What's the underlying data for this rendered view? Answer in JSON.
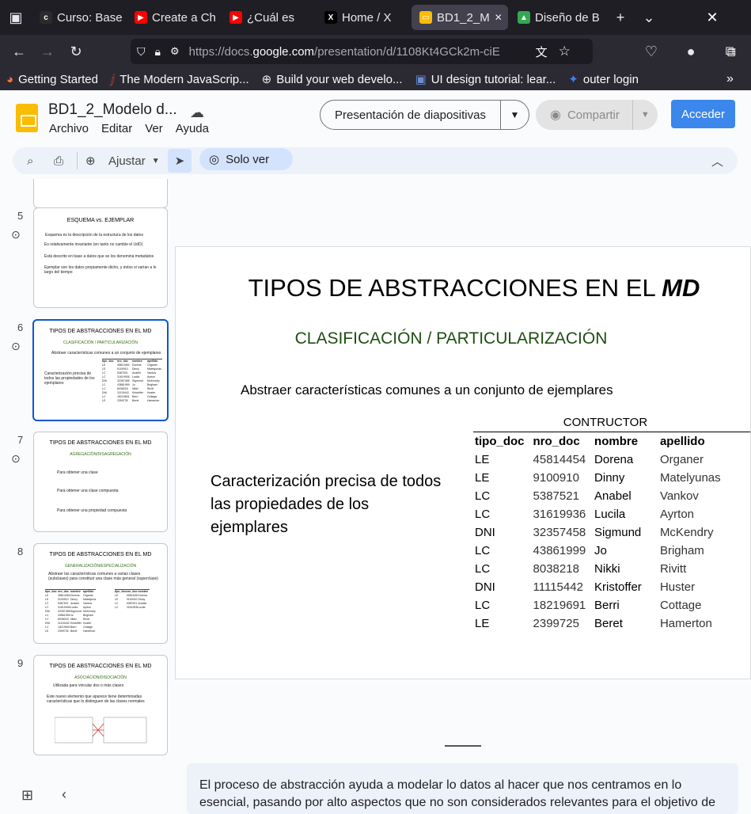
{
  "browser": {
    "tabs": [
      {
        "label": "Curso: Base",
        "icon": "course-icon",
        "color": "#2b2b2b"
      },
      {
        "label": "Create a Ch",
        "icon": "youtube-icon",
        "color": "#ff0000"
      },
      {
        "label": "¿Cuál es",
        "icon": "youtube-icon",
        "color": "#ff0000"
      },
      {
        "label": "Home / X",
        "icon": "x-icon",
        "color": "#000000"
      },
      {
        "label": "BD1_2_M",
        "icon": "slides-icon",
        "color": "#fbbc04"
      },
      {
        "label": "Diseño de B",
        "icon": "drive-icon",
        "color": "#34a853"
      }
    ],
    "url_prefix": "https://docs.",
    "url_domain": "google.com",
    "url_rest": "/presentation/d/1108Kt4GCk2m-ciE",
    "bookmarks": [
      {
        "label": "Getting Started",
        "icon": "firefox-icon"
      },
      {
        "label": "The Modern JavaScrip...",
        "icon": "js-icon"
      },
      {
        "label": "Build your web develo...",
        "icon": "globe-icon"
      },
      {
        "label": "UI design tutorial: lear...",
        "icon": "image-icon"
      },
      {
        "label": "outer login",
        "icon": "outer-icon"
      }
    ]
  },
  "app": {
    "doc_title": "BD1_2_Modelo d...",
    "menu": [
      "Archivo",
      "Editar",
      "Ver",
      "Ayuda"
    ],
    "present_label": "Presentación de diapositivas",
    "share_label": "Compartir",
    "signin_label": "Acceder",
    "zoom_label": "Ajustar",
    "view_mode_label": "Solo ver",
    "accent": "#1a73e8"
  },
  "thumbnails": [
    {
      "num": "5",
      "title": "ESQUEMA vs. EJEMPLAR",
      "lines": [
        "Esquema es la descripción de la estructura de los datos",
        "Es relativamente invariante (en tanto no cambie el UdD)",
        "Está descrito en base a datos que se los denomina metadatos",
        "Ejemplar son los datos propiamente dicho, y éstos si varían a lo largo del tiempo"
      ]
    },
    {
      "num": "6",
      "title": "TIPOS DE ABSTRACCIONES EN EL MD",
      "sub": "CLASIFICACIÓN / PARTICULARIZACIÓN",
      "lines": [
        "Abstraer características comunes a un conjunto de ejemplares",
        "Caracterización precisa de todos las propiedades de los ejemplares"
      ]
    },
    {
      "num": "7",
      "title": "TIPOS DE ABSTRACCIONES EN EL MD",
      "sub": "AGREGACIÓN/DISAGREGACIÓN",
      "lines": [
        "Para obtener una clase",
        "Para obtener una clase compuesta",
        "Para obtener una propiedad compuesta"
      ]
    },
    {
      "num": "8",
      "title": "TIPOS DE ABSTRACCIONES EN EL MD",
      "sub": "GENERALIZACIÓN/ESPECIALIZACIÓN",
      "lines": [
        "Abstraer las características comunes a varias clases (subclases) para constituir una clase más general (superclase)"
      ]
    },
    {
      "num": "9",
      "title": "TIPOS DE ABSTRACCIONES EN EL MD",
      "sub": "ASOCIACIÓN/DISOCIACIÓN",
      "lines": [
        "Utilizada para vincular dos o más clases",
        "Este nuevo elemento que aparece tiene determinadas características que lo distinguen de las clases normales"
      ]
    }
  ],
  "slide": {
    "title_plain": "TIPOS DE ABSTRACCIONES EN EL ",
    "title_em": "MD",
    "subtitle": "CLASIFICACIÓN / PARTICULARIZACIÓN",
    "abstract": "Abstraer características comunes a un conjunto de ejemplares",
    "characterization": "Caracterización precisa de todos las propiedades de los ejemplares",
    "table_caption": "CONTRUCTOR",
    "table_headers": [
      "tipo_doc",
      "nro_doc",
      "nombre",
      "apellido"
    ],
    "table_rows": [
      [
        "LE",
        "45814454",
        "Dorena",
        "Organer"
      ],
      [
        "LE",
        "9100910",
        "Dinny",
        "Matelyunas"
      ],
      [
        "LC",
        "5387521",
        "Anabel",
        "Vankov"
      ],
      [
        "LC",
        "31619936",
        "Lucila",
        "Ayrton"
      ],
      [
        "DNI",
        "32357458",
        "Sigmund",
        "McKendry"
      ],
      [
        "LC",
        "43861999",
        "Jo",
        "Brigham"
      ],
      [
        "LC",
        "8038218",
        "Nikki",
        "Rivitt"
      ],
      [
        "DNI",
        "11115442",
        "Kristoffer",
        "Huster"
      ],
      [
        "LC",
        "18219691",
        "Berri",
        "Cottage"
      ],
      [
        "LE",
        "2399725",
        "Beret",
        "Hamerton"
      ]
    ],
    "subtitle_color": "#1e4e12"
  },
  "notes": {
    "text": "El proceso de abstracción ayuda a modelar lo datos al hacer que nos centramos en lo esencial, pasando por alto aspectos que no son considerados relevantes para el objetivo de"
  }
}
